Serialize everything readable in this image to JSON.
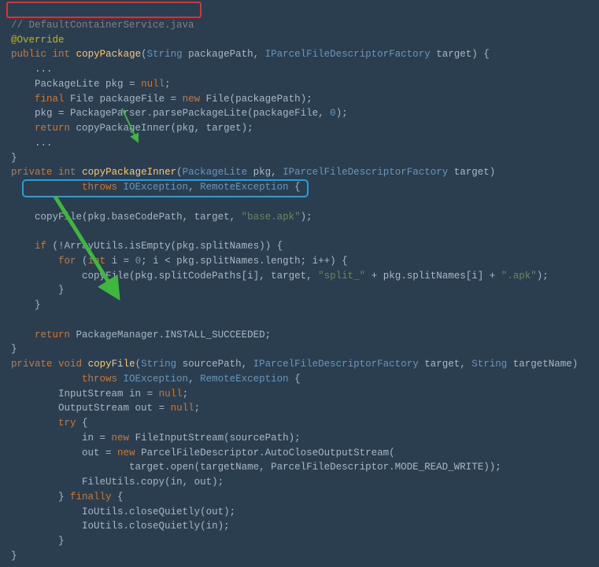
{
  "file_comment": "// DefaultContainerService.java",
  "override": "@Override",
  "l1": {
    "kw1": "public",
    "kw2": "int",
    "method": "copyPackage",
    "p1t": "String",
    "p1n": "packagePath",
    "p2t": "IParcelFileDescriptorFactory",
    "p2n": "target",
    "brace": ") {"
  },
  "l2": {
    "dots": "..."
  },
  "l3": {
    "t": "PackageLite",
    "v": "pkg",
    "eq": " = ",
    "kw": "null",
    "semi": ";"
  },
  "l4": {
    "kw1": "final",
    "t": "File",
    "v": "packageFile",
    "eq": " = ",
    "kw2": "new",
    "ctor": "File",
    "arg": "packagePath",
    "close": ");"
  },
  "l5": {
    "v": "pkg",
    "eq": " = ",
    "cls": "PackageParser",
    "dot": ".",
    "m": "parsePackageLite",
    "a1": "packageFile",
    "a2": "0",
    "close": ");"
  },
  "l6": {
    "kw": "return",
    "m": "copyPackageInner",
    "a1": "pkg",
    "a2": "target",
    "close": ");"
  },
  "l7": {
    "dots": "..."
  },
  "l8": {
    "brace": "}"
  },
  "l9": {
    "kw1": "private",
    "kw2": "int",
    "method": "copyPackageInner",
    "p1t": "PackageLite",
    "p1n": "pkg",
    "p2t": "IParcelFileDescriptorFactory",
    "p2n": "target",
    "close": ")"
  },
  "l10": {
    "kw": "throws",
    "e1": "IOException",
    "e2": "RemoteException",
    "brace": " {"
  },
  "l11": {
    "m": "copyFile",
    "a1": "pkg",
    "dot": ".",
    "f": "baseCodePath",
    "a2": "target",
    "s": "\"base.apk\"",
    "close": ");"
  },
  "l12": {
    "kw": "if",
    "neg": "!",
    "cls": "ArrayUtils",
    "dot": ".",
    "m": "isEmpty",
    "a1": "pkg",
    "dot2": ".",
    "f": "splitNames",
    "close": ")) {"
  },
  "l13": {
    "kw": "for",
    "open": " (",
    "kw2": "int",
    "v": "i",
    "eq": " = ",
    "n0": "0",
    "semi": "; ",
    "cmp": "i < pkg.splitNames.length; i++) {"
  },
  "l14": {
    "m": "copyFile",
    "a1": "pkg",
    "dot": ".",
    "f": "splitCodePaths",
    "idx": "[i]",
    "a2": "target",
    "s1": "\"split_\"",
    "plus1": " + pkg.splitNames[i] + ",
    "s2": "\".apk\"",
    "close": ");"
  },
  "l15": {
    "brace": "}"
  },
  "l16": {
    "brace": "}"
  },
  "l17": {
    "kw": "return",
    "cls": "PackageManager",
    "dot": ".",
    "f": "INSTALL_SUCCEEDED",
    "semi": ";"
  },
  "l18": {
    "brace": "}"
  },
  "l19": {
    "kw1": "private",
    "kw2": "void",
    "method": "copyFile",
    "p1t": "String",
    "p1n": "sourcePath",
    "p2t": "IParcelFileDescriptorFactory",
    "p2n": "target",
    "p3t": "String",
    "p3n": "targetName",
    "close": ")"
  },
  "l20": {
    "kw": "throws",
    "e1": "IOException",
    "e2": "RemoteException",
    "brace": " {"
  },
  "l21": {
    "t": "InputStream",
    "v": "in",
    "eq": " = ",
    "kw": "null",
    "semi": ";"
  },
  "l22": {
    "t": "OutputStream",
    "v": "out",
    "eq": " = ",
    "kw": "null",
    "semi": ";"
  },
  "l23": {
    "kw": "try",
    "brace": " {"
  },
  "l24": {
    "v": "in",
    "eq": " = ",
    "kw": "new",
    "ctor": "FileInputStream",
    "arg": "sourcePath",
    "close": ");"
  },
  "l25": {
    "v": "out",
    "eq": " = ",
    "kw": "new",
    "ctor": "ParcelFileDescriptor",
    "dot": ".",
    "inner": "AutoCloseOutputStream",
    "open": "("
  },
  "l26": {
    "obj": "target",
    "dot": ".",
    "m": "open",
    "a1": "targetName",
    "cls": "ParcelFileDescriptor",
    "dot2": ".",
    "f": "MODE_READ_WRITE",
    "close": "));"
  },
  "l27": {
    "cls": "FileUtils",
    "dot": ".",
    "m": "copy",
    "a1": "in",
    "a2": "out",
    "close": ");"
  },
  "l28": {
    "brace": "} ",
    "kw": "finally",
    "brace2": " {"
  },
  "l29": {
    "cls": "IoUtils",
    "dot": ".",
    "m": "closeQuietly",
    "a1": "out",
    "close": ");"
  },
  "l30": {
    "cls": "IoUtils",
    "dot": ".",
    "m": "closeQuietly",
    "a1": "in",
    "close": ");"
  },
  "l31": {
    "brace": "}"
  },
  "l32": {
    "brace": "}"
  }
}
